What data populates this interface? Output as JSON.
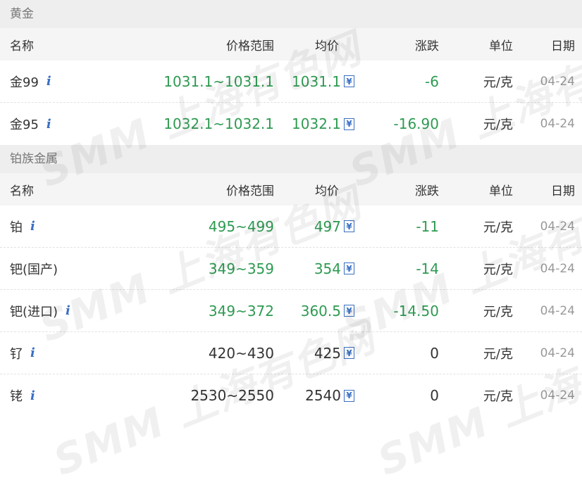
{
  "watermark": "SMM 上海有色网",
  "columns": {
    "name": "名称",
    "range": "价格范围",
    "avg": "均价",
    "change": "涨跌",
    "unit": "单位",
    "date": "日期"
  },
  "colors": {
    "price_green": "#2e9a52",
    "icon_blue": "#3a6fc4",
    "section_bg": "#eeeeee",
    "header_bg": "#f5f5f5"
  },
  "sections": [
    {
      "title": "黄金",
      "rows": [
        {
          "name": "金99",
          "range": "1031.1~1031.1",
          "avg": "1031.1",
          "change": "-6",
          "unit": "元/克",
          "date": "04-24"
        },
        {
          "name": "金95",
          "range": "1032.1~1032.1",
          "avg": "1032.1",
          "change": "-16.90",
          "unit": "元/克",
          "date": "04-24"
        }
      ]
    },
    {
      "title": "铂族金属",
      "rows": [
        {
          "name": "铂",
          "range": "495~499",
          "avg": "497",
          "change": "-11",
          "unit": "元/克",
          "date": "04-24"
        },
        {
          "name": "钯(国产)",
          "range": "349~359",
          "avg": "354",
          "change": "-14",
          "unit": "元/克",
          "date": "04-24"
        },
        {
          "name": "钯(进口)",
          "range": "349~372",
          "avg": "360.5",
          "change": "-14.50",
          "unit": "元/克",
          "date": "04-24"
        },
        {
          "name": "钌",
          "range": "420~430",
          "avg": "425",
          "change": "0",
          "unit": "元/克",
          "date": "04-24"
        },
        {
          "name": "铑",
          "range": "2530~2550",
          "avg": "2540",
          "change": "0",
          "unit": "元/克",
          "date": "04-24"
        }
      ]
    }
  ]
}
